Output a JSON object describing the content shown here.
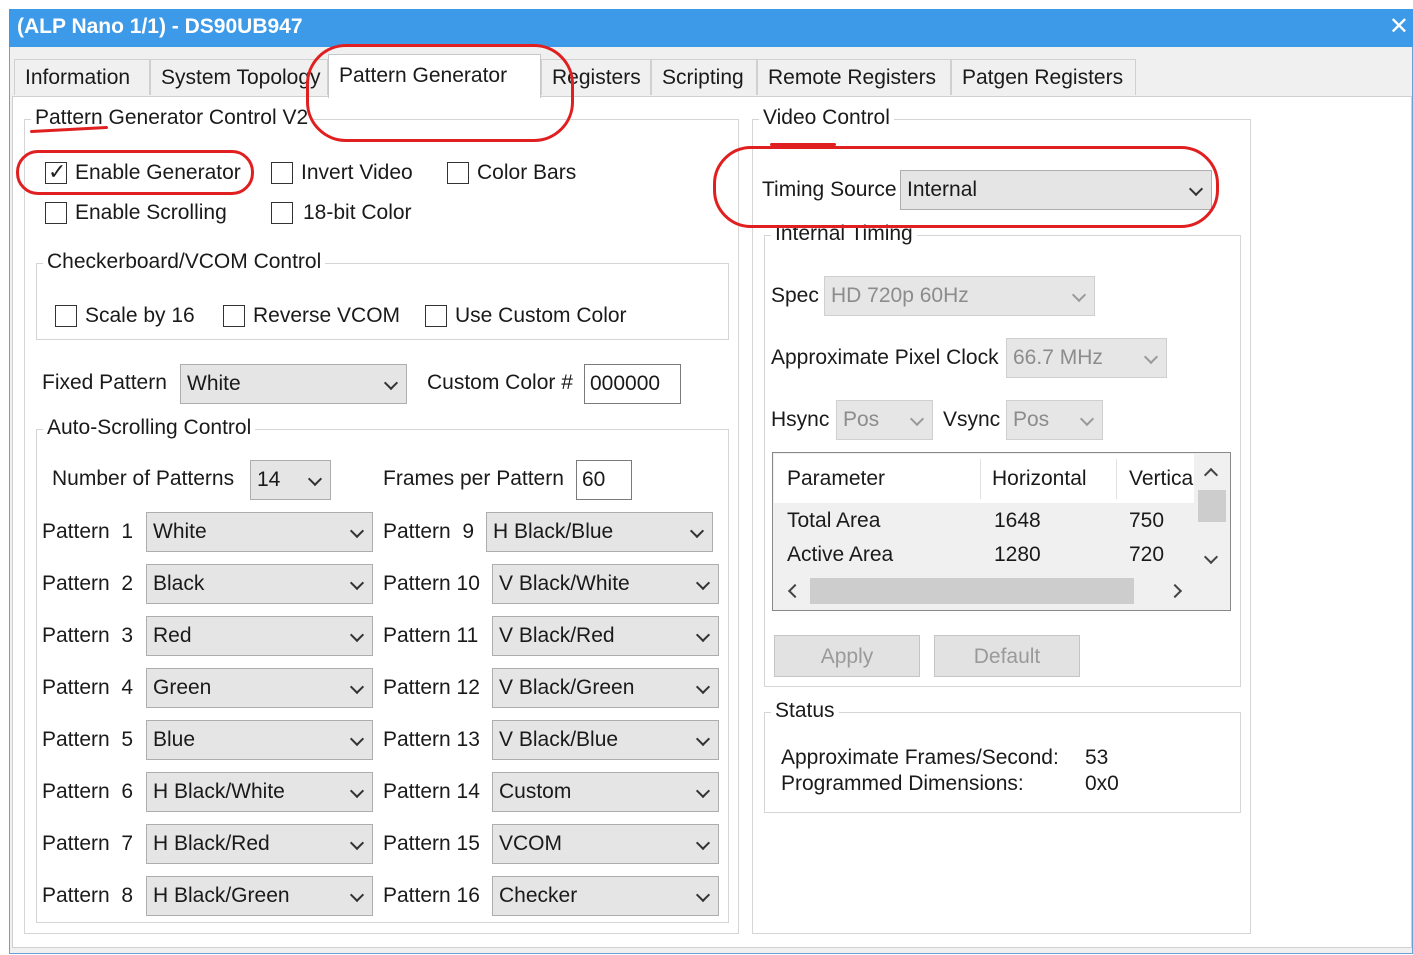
{
  "window": {
    "title": "(ALP Nano 1/1) - DS90UB947",
    "close_glyph": "✕"
  },
  "tabs": [
    "Information",
    "System Topology",
    "Pattern Generator",
    "Registers",
    "Scripting",
    "Remote Registers",
    "Patgen Registers"
  ],
  "active_tab": "Pattern Generator",
  "pg": {
    "group_label": "Pattern Generator Control V2",
    "enable_generator": "Enable Generator",
    "invert_video": "Invert Video",
    "color_bars": "Color Bars",
    "enable_scrolling": "Enable Scrolling",
    "bit18": "18-bit Color",
    "checker_group": "Checkerboard/VCOM Control",
    "scale16": "Scale by 16",
    "reverse_vcom": "Reverse VCOM",
    "use_custom": "Use Custom Color",
    "fixed_label": "Fixed Pattern",
    "fixed_value": "White",
    "custom_label": "Custom Color #",
    "custom_value": "000000",
    "auto_group": "Auto-Scrolling Control",
    "num_label": "Number of Patterns",
    "num_value": "14",
    "fpp_label": "Frames per Pattern",
    "fpp_value": "60",
    "patterns_left": [
      {
        "label": "Pattern  1",
        "value": "White"
      },
      {
        "label": "Pattern  2",
        "value": "Black"
      },
      {
        "label": "Pattern  3",
        "value": "Red"
      },
      {
        "label": "Pattern  4",
        "value": "Green"
      },
      {
        "label": "Pattern  5",
        "value": "Blue"
      },
      {
        "label": "Pattern  6",
        "value": "H Black/White"
      },
      {
        "label": "Pattern  7",
        "value": "H Black/Red"
      },
      {
        "label": "Pattern  8",
        "value": "H Black/Green"
      }
    ],
    "patterns_right": [
      {
        "label": "Pattern  9",
        "value": "H Black/Blue"
      },
      {
        "label": "Pattern 10",
        "value": "V Black/White"
      },
      {
        "label": "Pattern 11",
        "value": "V Black/Red"
      },
      {
        "label": "Pattern 12",
        "value": "V Black/Green"
      },
      {
        "label": "Pattern 13",
        "value": "V Black/Blue"
      },
      {
        "label": "Pattern 14",
        "value": "Custom"
      },
      {
        "label": "Pattern 15",
        "value": "VCOM"
      },
      {
        "label": "Pattern 16",
        "value": "Checker"
      }
    ]
  },
  "video": {
    "group_label": "Video Control",
    "timing_label": "Timing Source",
    "timing_value": "Internal",
    "internal_group": "Internal Timing",
    "spec_label": "Spec",
    "spec_value": "HD 720p 60Hz",
    "clock_label": "Approximate Pixel Clock",
    "clock_value": "66.7 MHz",
    "hsync_label": "Hsync",
    "hsync_value": "Pos",
    "vsync_label": "Vsync",
    "vsync_value": "Pos",
    "grid_headers": [
      "Parameter",
      "Horizontal",
      "Vertica"
    ],
    "grid_rows": [
      [
        "Total Area",
        "1648",
        "750"
      ],
      [
        "Active Area",
        "1280",
        "720"
      ]
    ],
    "apply": "Apply",
    "default": "Default",
    "status_group": "Status",
    "fps_label": "Approximate Frames/Second:",
    "fps_value": "53",
    "dims_label": "Programmed Dimensions:",
    "dims_value": "0x0"
  }
}
